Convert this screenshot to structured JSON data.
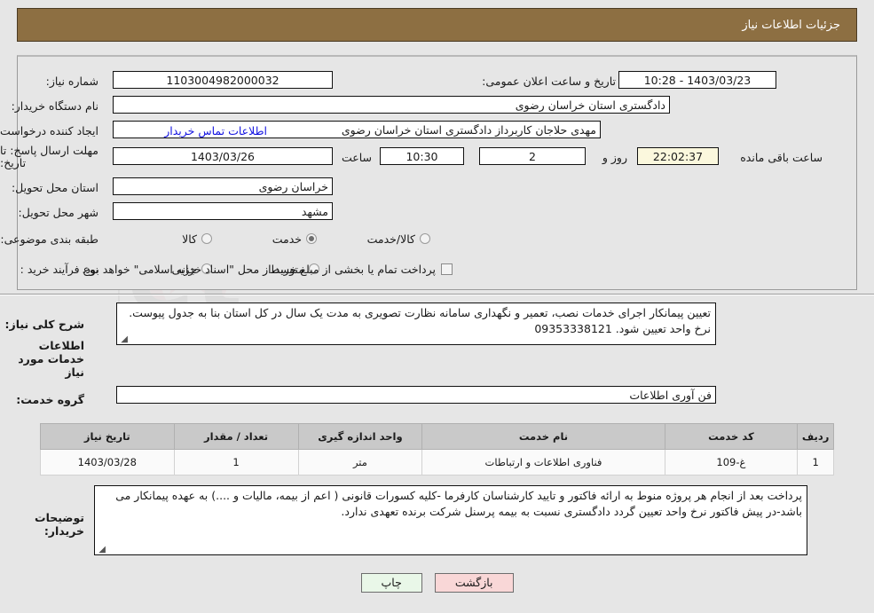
{
  "header": {
    "title": "جزئیات اطلاعات نیاز"
  },
  "watermark": {
    "text": "ArtaTender.net"
  },
  "form": {
    "need_number_label": "شماره نیاز:",
    "need_number_value": "1103004982000032",
    "announce_datetime_label": "تاریخ و ساعت اعلان عمومی:",
    "announce_datetime_value": "1403/03/23 - 10:28",
    "buyer_org_label": "نام دستگاه خریدار:",
    "buyer_org_value": "دادگستری استان خراسان رضوی",
    "creator_label": "ایجاد کننده درخواست:",
    "creator_value": "مهدی حلاجان کاربرداز دادگستری استان خراسان رضوی",
    "contact_link": "اطلاعات تماس خریدار",
    "deadline_label": "مهلت ارسال پاسخ: تا تاریخ:",
    "deadline_date": "1403/03/26",
    "hour_label": "ساعت",
    "deadline_time": "10:30",
    "days_value": "2",
    "days_label": "روز و",
    "countdown_value": "22:02:37",
    "countdown_label": "ساعت باقی مانده",
    "province_label": "استان محل تحویل:",
    "province_value": "خراسان رضوی",
    "city_label": "شهر محل تحویل:",
    "city_value": "مشهد",
    "category_label": "طبقه بندی موضوعی:",
    "category_options": [
      {
        "label": "کالا",
        "selected": false
      },
      {
        "label": "خدمت",
        "selected": true
      },
      {
        "label": "کالا/خدمت",
        "selected": false
      }
    ],
    "process_label": "نوع فرآیند خرید :",
    "process_options": [
      {
        "label": "جزیی",
        "selected": false
      },
      {
        "label": "متوسط",
        "selected": false
      }
    ],
    "treasury_note": "پرداخت تمام یا بخشی از مبلغ خرید،از محل \"اسناد خزانه اسلامی\" خواهد بود."
  },
  "description": {
    "label": "شرح کلی نیاز:",
    "value": "تعیین پیمانکار اجرای خدمات نصب، تعمیر و نگهداری سامانه نظارت تصویری به مدت یک سال در کل استان بنا به جدول پیوست. نرخ واحد تعیین شود. 09353338121"
  },
  "services_section": {
    "heading": "اطلاعات خدمات مورد نیاز",
    "group_label": "گروه خدمت:",
    "group_value": "فن آوری اطلاعات"
  },
  "table": {
    "columns": [
      "ردیف",
      "کد خدمت",
      "نام خدمت",
      "واحد اندازه گیری",
      "تعداد / مقدار",
      "تاریخ نیاز"
    ],
    "rows": [
      [
        "1",
        "غ-109",
        "فناوری اطلاعات و ارتباطات",
        "متر",
        "1",
        "1403/03/28"
      ]
    ]
  },
  "buyer_notes": {
    "label": "توضیحات خریدار:",
    "value": "پرداخت بعد از انجام هر پروژه منوط به ارائه فاکتور و تایید کارشناسان کارفرما -کلیه کسورات قانونی ( اعم از بیمه، مالیات و ....) به عهده پیمانکار می باشد-در پیش فاکتور نرخ واحد تعیین گردد دادگستری نسبت به بیمه پرسنل شرکت برنده تعهدی ندارد."
  },
  "buttons": {
    "print": "چاپ",
    "back": "بازگشت"
  },
  "colors": {
    "header_bar": "#8d6f42",
    "page_bg": "#e6e6e6",
    "link": "#1313e0",
    "print_btn": "#e9f7e8",
    "back_btn": "#f9d7d7",
    "countdown_bg": "#fbf8dd",
    "table_header": "#c9c9c9"
  }
}
